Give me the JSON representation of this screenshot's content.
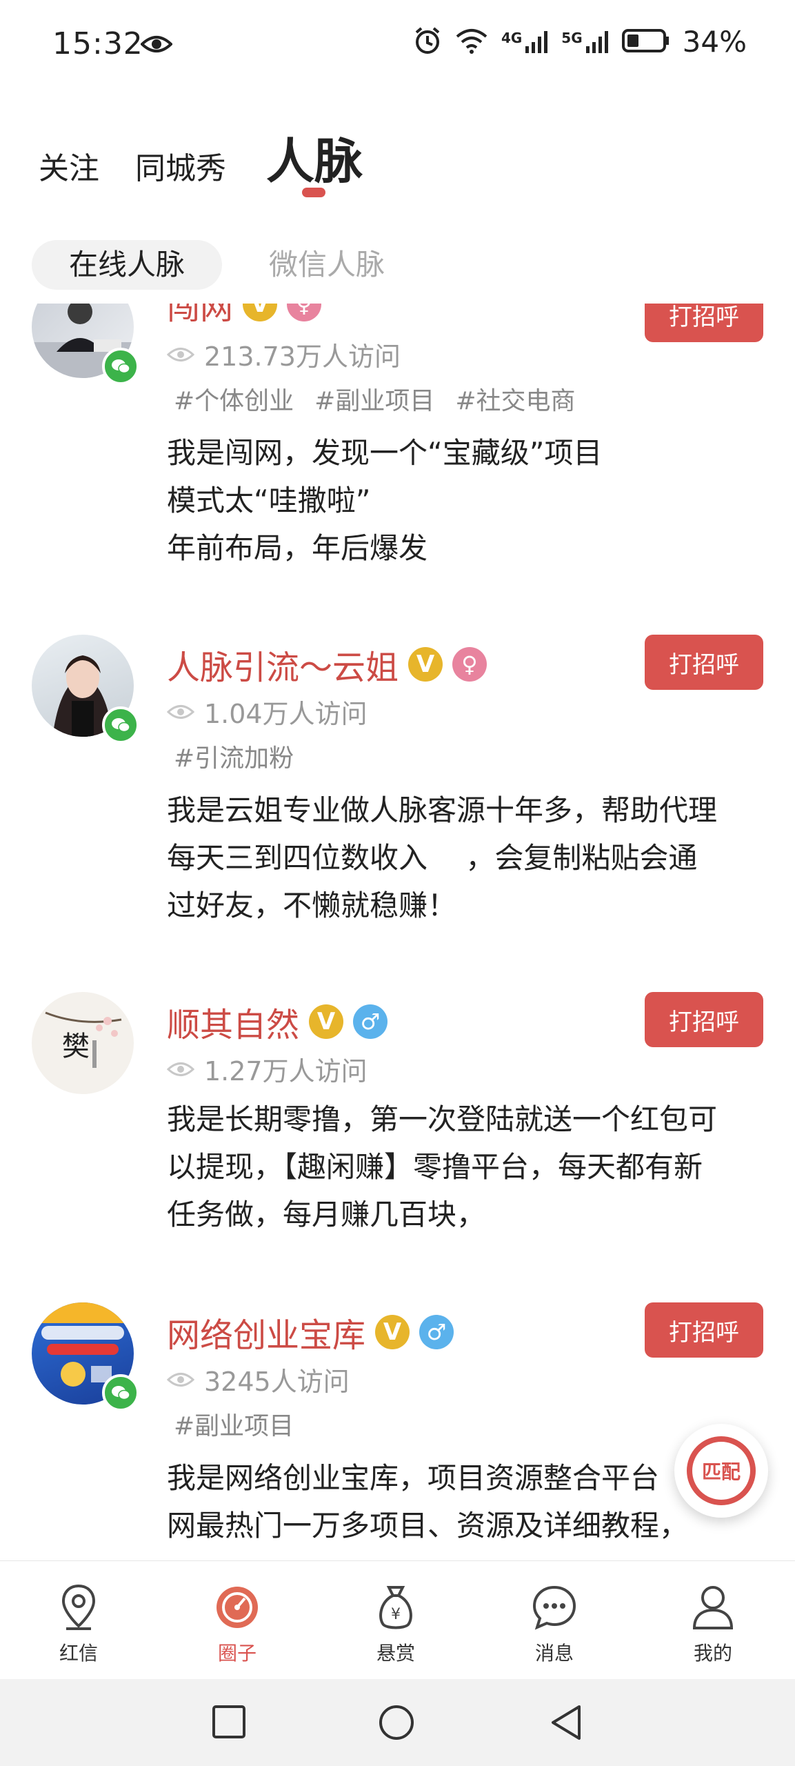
{
  "status_bar": {
    "time": "15:32",
    "battery_pct": "34%",
    "net1": "4G",
    "net2": "5G"
  },
  "top_tabs": [
    {
      "label": "关注"
    },
    {
      "label": "同城秀"
    },
    {
      "label": "人脉",
      "active": true
    }
  ],
  "sub_tabs": [
    {
      "label": "在线人脉",
      "active": true
    },
    {
      "label": "微信人脉"
    }
  ],
  "feed": [
    {
      "name": "闯网",
      "visits": "213.73万人访问",
      "tags": [
        "#个体创业",
        "#副业项目",
        "#社交电商"
      ],
      "desc": [
        "我是闯网，发现一个“宝藏级”项目",
        "模式太“哇撒啦”",
        "年前布局，年后爆发"
      ],
      "gender": "female",
      "greet": "打招呼"
    },
    {
      "name": "人脉引流～云姐",
      "visits": "1.04万人访问",
      "tags": [
        "#引流加粉"
      ],
      "desc": [
        "我是云姐专业做人脉客源十年多，帮助代理",
        "每天三到四位数收入　 ，会复制粘贴会通",
        "过好友，不懒就稳赚！"
      ],
      "gender": "female",
      "greet": "打招呼"
    },
    {
      "name": "顺其自然",
      "visits": "1.27万人访问",
      "tags": [],
      "desc": [
        "我是长期零撸，第一次登陆就送一个红包可",
        "以提现，【趣闲赚】零撸平台，每天都有新",
        "任务做，每月赚几百块，"
      ],
      "gender": "male",
      "greet": "打招呼"
    },
    {
      "name": "网络创业宝库",
      "visits": "3245人访问",
      "tags": [
        "#副业项目"
      ],
      "desc": [
        "我是网络创业宝库，项目资源整合平台",
        "网最热门一万多项目、资源及详细教程，"
      ],
      "gender": "male",
      "greet": "打招呼"
    }
  ],
  "match_button": {
    "label": "匹配"
  },
  "bottom_nav": [
    {
      "label": "红信",
      "icon": "location-pin-icon"
    },
    {
      "label": "圈子",
      "icon": "circle-compass-icon",
      "active": true
    },
    {
      "label": "悬赏",
      "icon": "money-bag-icon"
    },
    {
      "label": "消息",
      "icon": "chat-bubble-icon"
    },
    {
      "label": "我的",
      "icon": "person-icon"
    }
  ],
  "colors": {
    "accent": "#d9534f",
    "name": "#cc4b45",
    "vip": "#e7b52b",
    "wechat": "#3cb34a"
  }
}
